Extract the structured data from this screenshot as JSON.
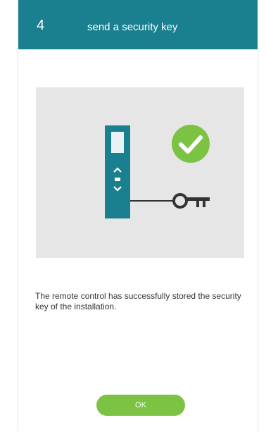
{
  "header": {
    "step": "4",
    "title": "send a security key"
  },
  "illustration": {
    "icons": [
      "remote-control-icon",
      "success-check-icon",
      "key-icon"
    ],
    "colors": {
      "remote": "#1a7f8f",
      "check": "#7cc243",
      "key": "#333333",
      "background": "#e6e6e6"
    }
  },
  "message": "The remote control has successfully stored the security key of the installation.",
  "actions": {
    "ok_label": "OK"
  },
  "colors": {
    "header": "#1a7f8f",
    "accent": "#7cc243"
  }
}
